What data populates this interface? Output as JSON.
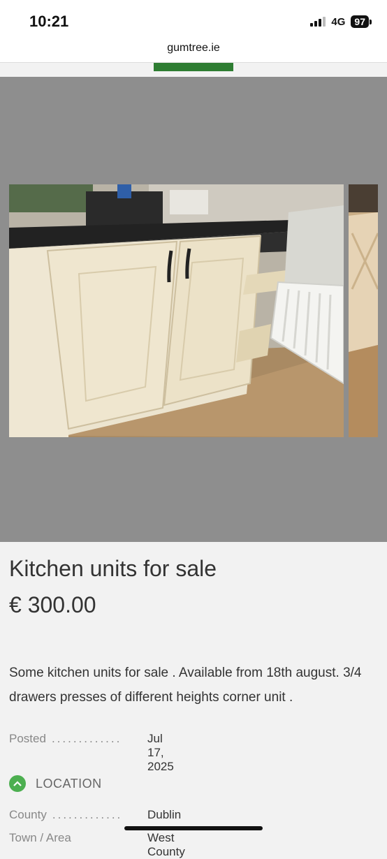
{
  "status_bar": {
    "time": "10:21",
    "network": "4G",
    "battery": "97"
  },
  "browser": {
    "url": "gumtree.ie"
  },
  "listing": {
    "title": "Kitchen units for sale",
    "price": "€ 300.00",
    "description": "Some kitchen units for sale . Available from 18th august. 3/4 drawers presses of different heights corner unit .",
    "posted_label": "Posted",
    "posted_value": "Jul 17, 2025",
    "location_heading": "LOCATION",
    "county_label": "County",
    "county_value": "Dublin",
    "town_label": "Town / Area",
    "town_value": "West County"
  },
  "colors": {
    "accent_green": "#4caf50",
    "gallery_bg": "#8e8e8e"
  }
}
